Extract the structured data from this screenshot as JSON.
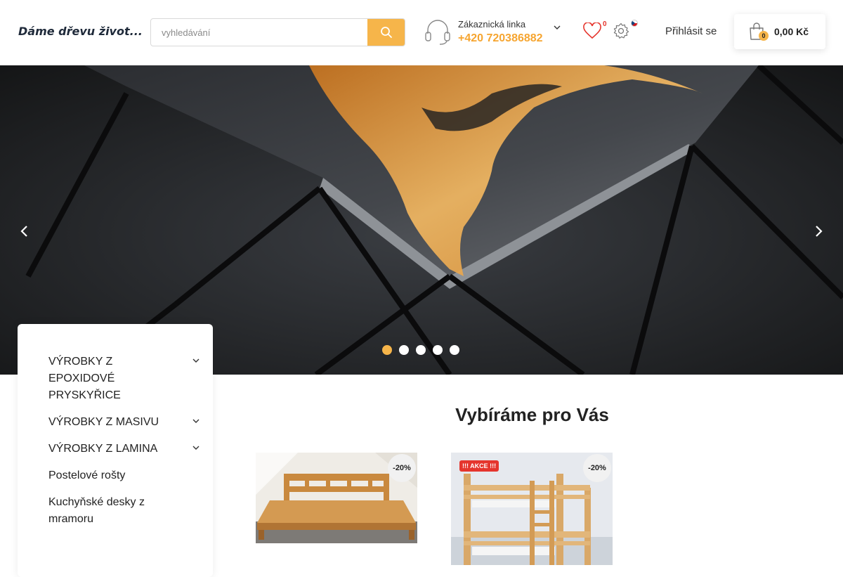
{
  "header": {
    "logo": "Dáme dřevu život...",
    "search_placeholder": "vyhledávání",
    "support_label": "Zákaznická linka",
    "support_phone": "+420 720386882",
    "wishlist_count": "0",
    "login": "Přihlásit se",
    "cart_count": "0",
    "cart_total": "0,00 Kč"
  },
  "hero": {
    "slides": 5,
    "active_slide": 1
  },
  "sidebar": {
    "items": [
      {
        "label": "VÝROBKY Z EPOXIDOVÉ PRYSKYŘICE",
        "has_submenu": true
      },
      {
        "label": "VÝROBKY Z MASIVU",
        "has_submenu": true
      },
      {
        "label": "VÝROBKY Z LAMINA",
        "has_submenu": true
      },
      {
        "label": "Postelové rošty",
        "has_submenu": false
      },
      {
        "label": "Kuchyňské desky z mramoru",
        "has_submenu": false
      }
    ]
  },
  "featured": {
    "title": "Vybíráme pro Vás",
    "products": [
      {
        "discount": "-20%",
        "badge": ""
      },
      {
        "discount": "-20%",
        "badge": "!!! AKCE !!!"
      }
    ]
  },
  "colors": {
    "accent": "#f6b54a",
    "phone": "#f6a530",
    "sale": "#e5352d"
  }
}
